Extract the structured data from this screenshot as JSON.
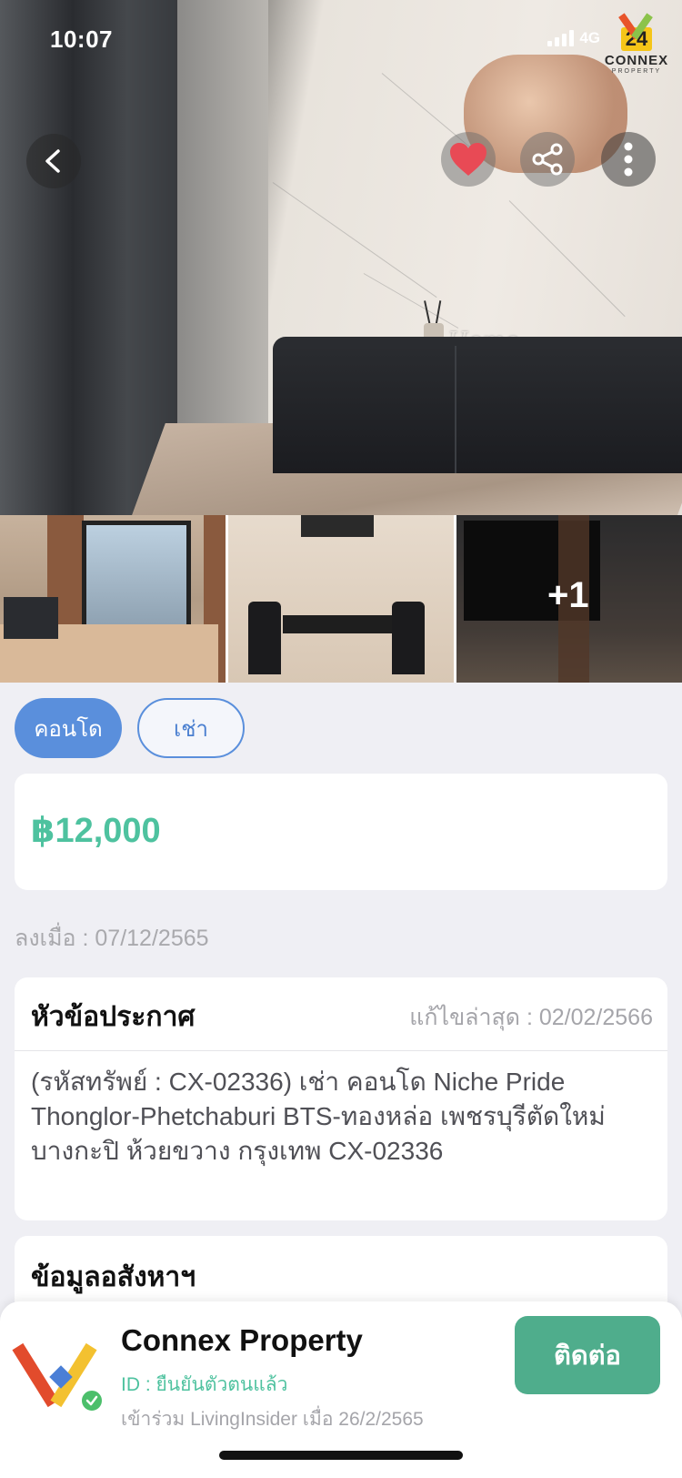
{
  "status_bar": {
    "time": "10:07",
    "network": "4G"
  },
  "brand_watermark": {
    "number": "24",
    "name": "CONNEX",
    "sub": "PROPERTY"
  },
  "gallery": {
    "more_count": "+1"
  },
  "tags": {
    "property_type": "คอนโด",
    "listing_type": "เช่า"
  },
  "price": {
    "value": "฿12,000",
    "color": "#4ec29f"
  },
  "posted": {
    "text": "ลงเมื่อ : 07/12/2565"
  },
  "title_card": {
    "heading": "หัวข้อประกาศ",
    "edited": "แก้ไขล่าสุด : 02/02/2566",
    "description": "(รหัสทรัพย์ : CX-02336) เช่า คอนโด  Niche Pride Thonglor-Phetchaburi BTS-ทองหล่อ เพชรบุรีตัดใหม่ บางกะปิ ห้วยขวาง กรุงเทพ CX-02336"
  },
  "info_card": {
    "heading": "ข้อมูลอสังหาฯ"
  },
  "agent": {
    "name": "Connex Property",
    "id_status": "ID : ยืนยันตัวตนแล้ว",
    "joined": "เข้าร่วม LivingInsider เมื่อ 26/2/2565",
    "contact_label": "ติดต่อ"
  },
  "colors": {
    "accent_blue": "#5a8fdc",
    "accent_green": "#4fad8c",
    "heart": "#e84a55"
  },
  "icons": [
    "back-icon",
    "heart-icon",
    "share-icon",
    "more-icon",
    "verified-check-icon"
  ]
}
